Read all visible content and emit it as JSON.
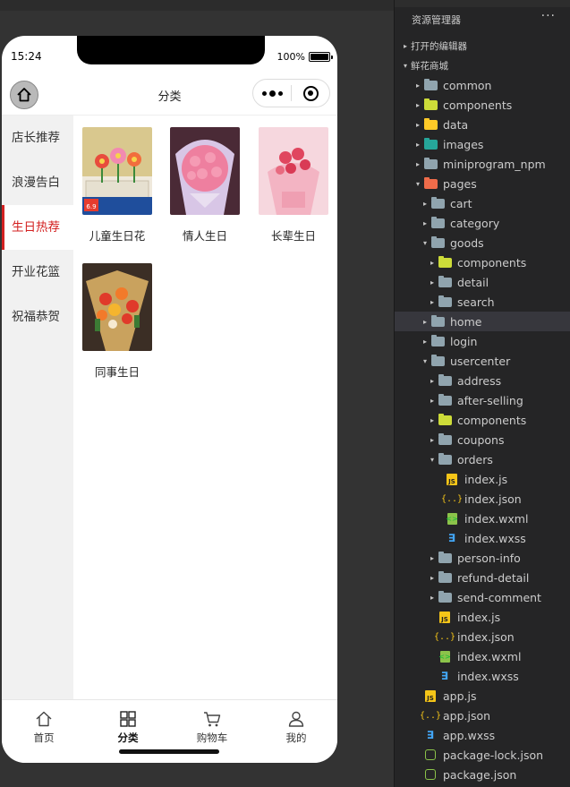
{
  "simulator": {
    "status_time": "15:24",
    "battery_percent": "100%",
    "battery_level": 1.0,
    "nav_title": "分类",
    "categories": [
      {
        "label": "店长推荐",
        "active": false
      },
      {
        "label": "浪漫告白",
        "active": false
      },
      {
        "label": "生日热荐",
        "active": true
      },
      {
        "label": "开业花篮",
        "active": false
      },
      {
        "label": "祝福恭贺",
        "active": false
      }
    ],
    "products": [
      {
        "name": "儿童生日花"
      },
      {
        "name": "情人生日"
      },
      {
        "name": "长辈生日"
      },
      {
        "name": "同事生日"
      }
    ],
    "tabs": [
      {
        "label": "首页",
        "icon": "home-icon",
        "active": false
      },
      {
        "label": "分类",
        "icon": "category-icon",
        "active": true
      },
      {
        "label": "购物车",
        "icon": "cart-icon",
        "active": false
      },
      {
        "label": "我的",
        "icon": "user-icon",
        "active": false
      }
    ],
    "colors": {
      "accent": "#d32121"
    }
  },
  "explorer": {
    "title": "资源管理器",
    "more": "···",
    "open_editors": "打开的编辑器",
    "project": "鲜花商城",
    "items": [
      {
        "label": "common",
        "type": "folder",
        "depth": 1,
        "arrow": "▸"
      },
      {
        "label": "components",
        "type": "folder-comp",
        "depth": 1,
        "arrow": "▸"
      },
      {
        "label": "data",
        "type": "folder-data",
        "depth": 1,
        "arrow": "▸"
      },
      {
        "label": "images",
        "type": "folder-img",
        "depth": 1,
        "arrow": "▸"
      },
      {
        "label": "miniprogram_npm",
        "type": "folder",
        "depth": 1,
        "arrow": "▸"
      },
      {
        "label": "pages",
        "type": "folder-pages",
        "depth": 1,
        "arrow": "▾"
      },
      {
        "label": "cart",
        "type": "folder",
        "depth": 2,
        "arrow": "▸"
      },
      {
        "label": "category",
        "type": "folder",
        "depth": 2,
        "arrow": "▸"
      },
      {
        "label": "goods",
        "type": "folder",
        "depth": 2,
        "arrow": "▾"
      },
      {
        "label": "components",
        "type": "folder-comp",
        "depth": 3,
        "arrow": "▸"
      },
      {
        "label": "detail",
        "type": "folder",
        "depth": 3,
        "arrow": "▸"
      },
      {
        "label": "search",
        "type": "folder",
        "depth": 3,
        "arrow": "▸"
      },
      {
        "label": "home",
        "type": "folder",
        "depth": 2,
        "arrow": "▸",
        "selected": true
      },
      {
        "label": "login",
        "type": "folder",
        "depth": 2,
        "arrow": "▸"
      },
      {
        "label": "usercenter",
        "type": "folder",
        "depth": 2,
        "arrow": "▾"
      },
      {
        "label": "address",
        "type": "folder",
        "depth": 3,
        "arrow": "▸"
      },
      {
        "label": "after-selling",
        "type": "folder",
        "depth": 3,
        "arrow": "▸"
      },
      {
        "label": "components",
        "type": "folder-comp",
        "depth": 3,
        "arrow": "▸"
      },
      {
        "label": "coupons",
        "type": "folder",
        "depth": 3,
        "arrow": "▸"
      },
      {
        "label": "orders",
        "type": "folder",
        "depth": 3,
        "arrow": "▾"
      },
      {
        "label": "index.js",
        "type": "js",
        "depth": 4,
        "arrow": ""
      },
      {
        "label": "index.json",
        "type": "json",
        "depth": 4,
        "arrow": ""
      },
      {
        "label": "index.wxml",
        "type": "wxml",
        "depth": 4,
        "arrow": ""
      },
      {
        "label": "index.wxss",
        "type": "wxss",
        "depth": 4,
        "arrow": ""
      },
      {
        "label": "person-info",
        "type": "folder",
        "depth": 3,
        "arrow": "▸"
      },
      {
        "label": "refund-detail",
        "type": "folder",
        "depth": 3,
        "arrow": "▸"
      },
      {
        "label": "send-comment",
        "type": "folder",
        "depth": 3,
        "arrow": "▸"
      },
      {
        "label": "index.js",
        "type": "js",
        "depth": 3,
        "arrow": ""
      },
      {
        "label": "index.json",
        "type": "json",
        "depth": 3,
        "arrow": ""
      },
      {
        "label": "index.wxml",
        "type": "wxml",
        "depth": 3,
        "arrow": ""
      },
      {
        "label": "index.wxss",
        "type": "wxss",
        "depth": 3,
        "arrow": ""
      },
      {
        "label": "app.js",
        "type": "js",
        "depth": 1,
        "arrow": ""
      },
      {
        "label": "app.json",
        "type": "json",
        "depth": 1,
        "arrow": ""
      },
      {
        "label": "app.wxss",
        "type": "wxss",
        "depth": 1,
        "arrow": ""
      },
      {
        "label": "package-lock.json",
        "type": "npm",
        "depth": 1,
        "arrow": ""
      },
      {
        "label": "package.json",
        "type": "npm",
        "depth": 1,
        "arrow": ""
      }
    ]
  }
}
